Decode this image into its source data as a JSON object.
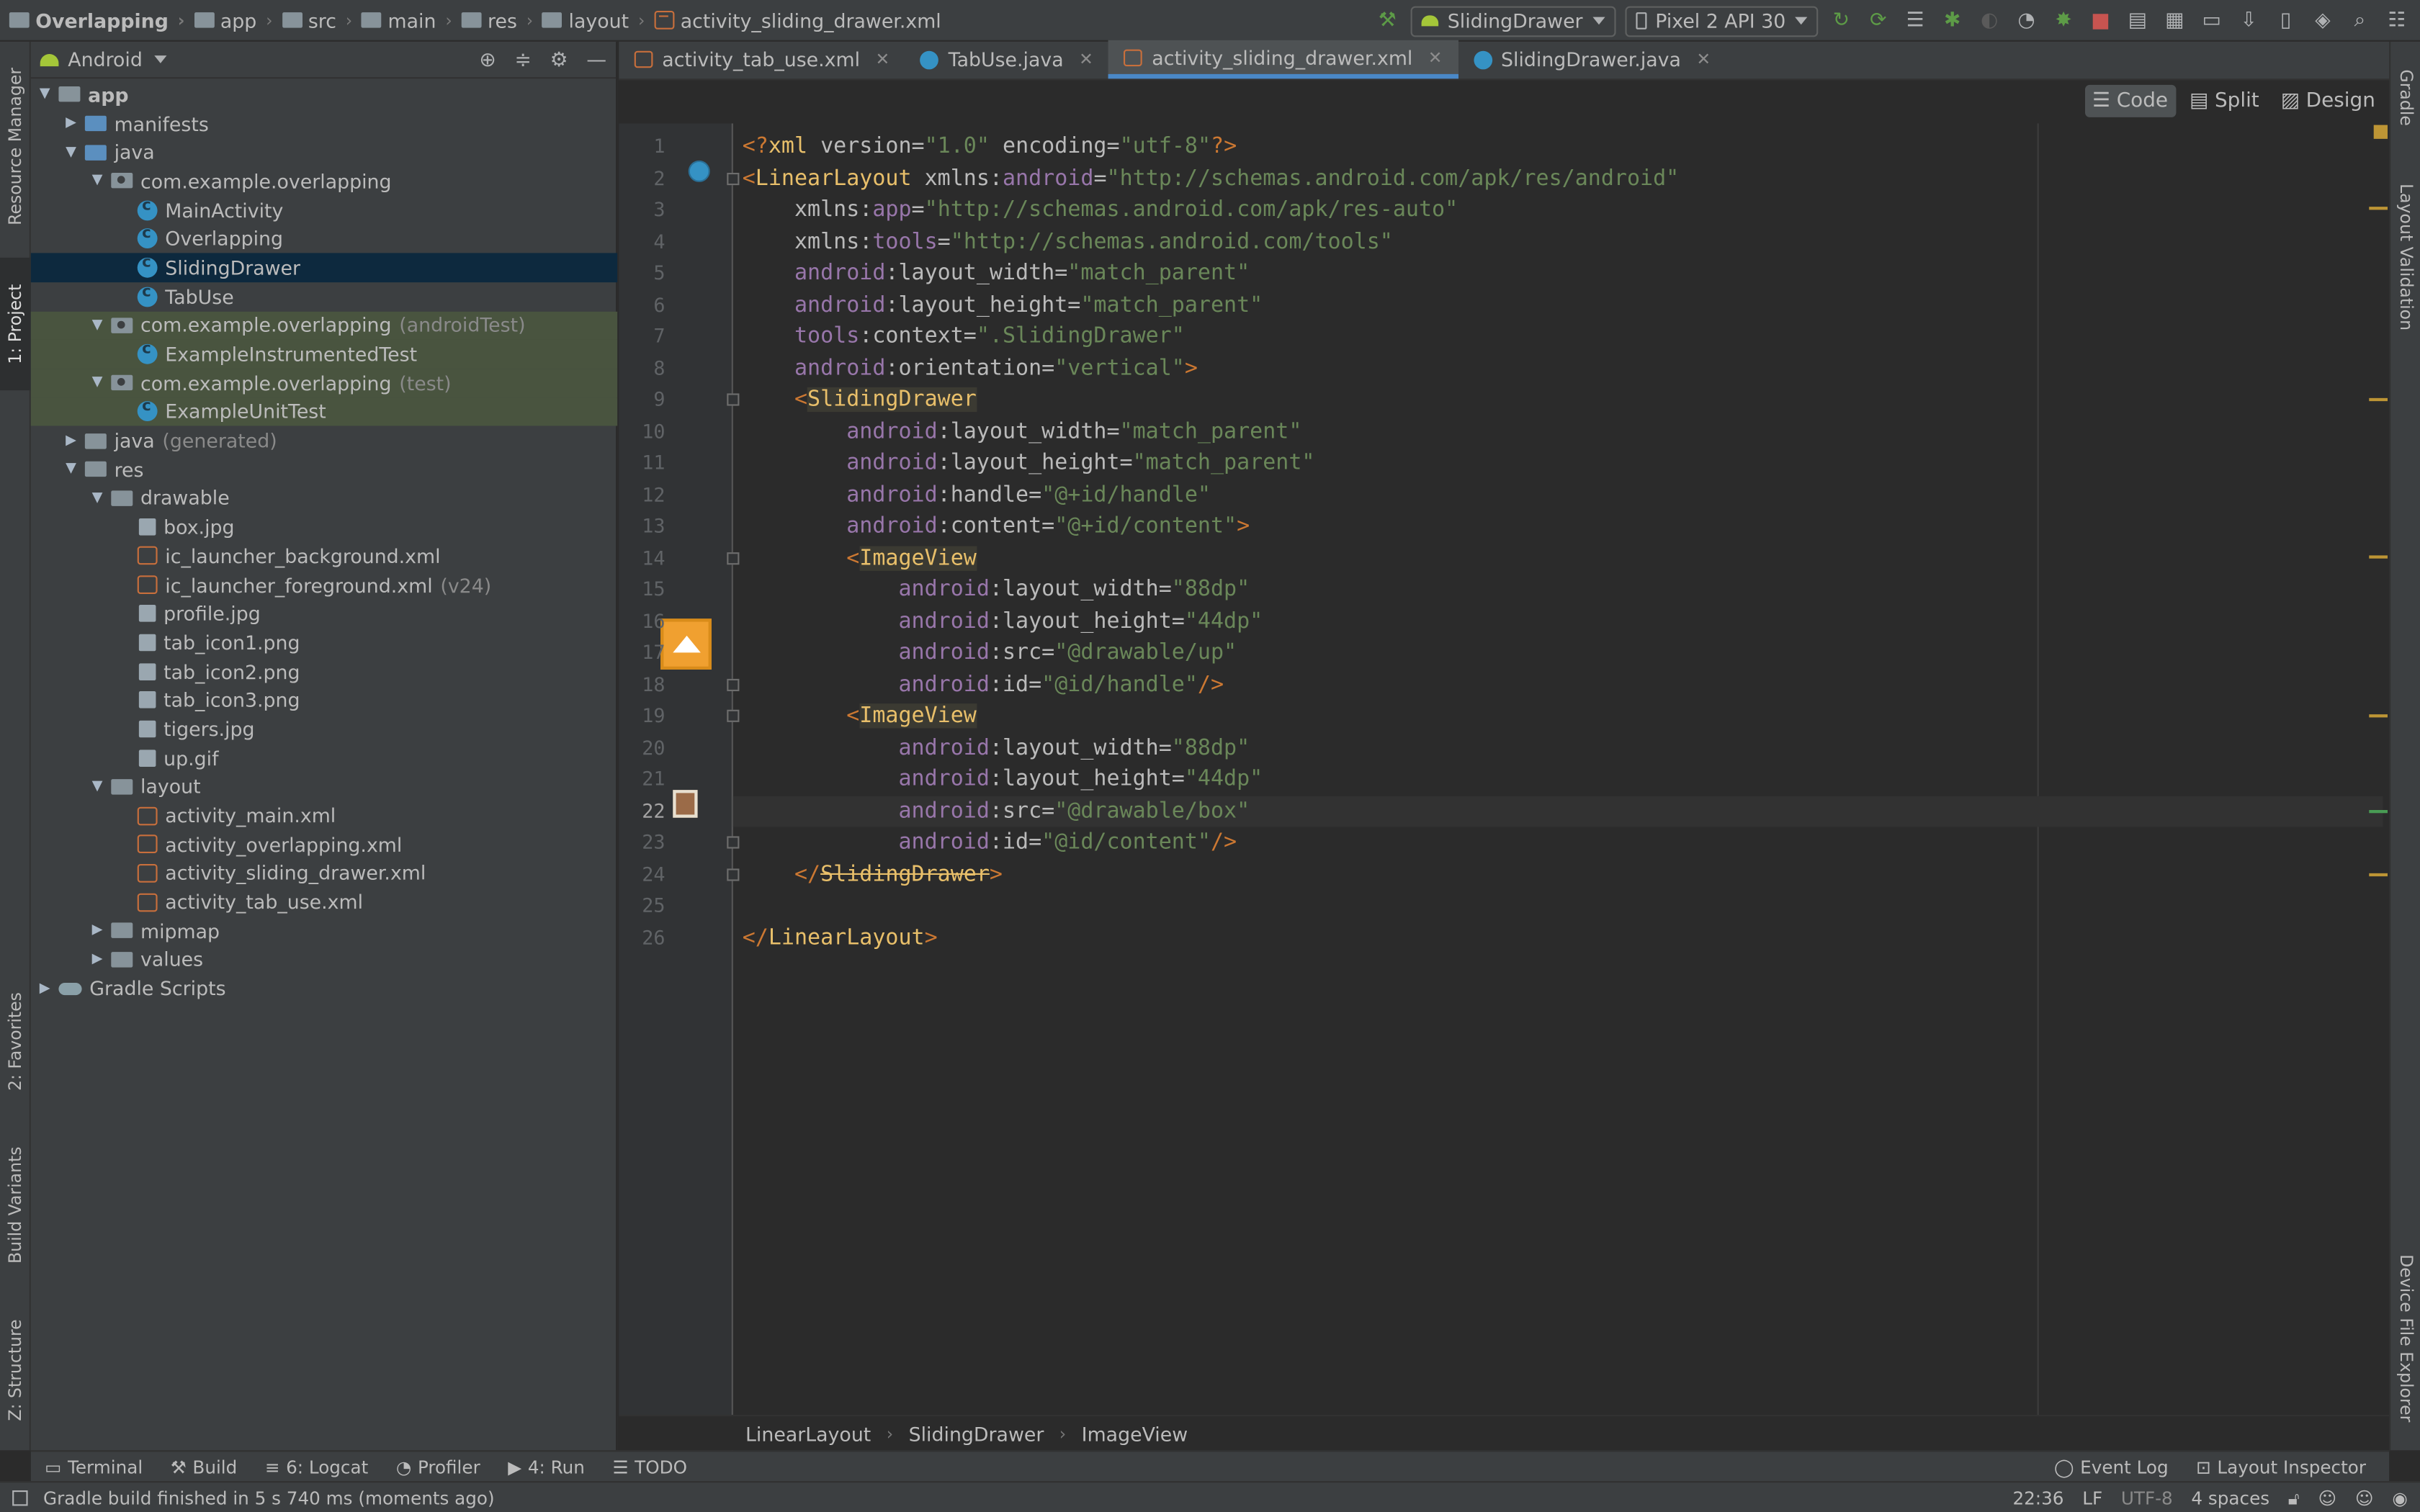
{
  "breadcrumbs": [
    "Overlapping",
    "app",
    "src",
    "main",
    "res",
    "layout",
    "activity_sliding_drawer.xml"
  ],
  "run_config": "SlidingDrawer",
  "device": "Pixel 2 API 30",
  "left_tabs": [
    "Resource Manager",
    "1: Project",
    "2: Favorites",
    "Build Variants",
    "Z: Structure"
  ],
  "right_tabs": [
    "Gradle",
    "Layout Validation",
    "Device File Explorer"
  ],
  "project_panel": {
    "view": "Android",
    "tree": [
      {
        "label": "app",
        "depth": 0,
        "icon": "folder",
        "arrow": "down",
        "bold": true
      },
      {
        "label": "manifests",
        "depth": 1,
        "icon": "folder-blue",
        "arrow": "right"
      },
      {
        "label": "java",
        "depth": 1,
        "icon": "folder-blue",
        "arrow": "down"
      },
      {
        "label": "com.example.overlapping",
        "depth": 2,
        "icon": "pkg",
        "arrow": "down"
      },
      {
        "label": "MainActivity",
        "depth": 3,
        "icon": "class"
      },
      {
        "label": "Overlapping",
        "depth": 3,
        "icon": "class"
      },
      {
        "label": "SlidingDrawer",
        "depth": 3,
        "icon": "class",
        "selected": true
      },
      {
        "label": "TabUse",
        "depth": 3,
        "icon": "class"
      },
      {
        "label": "com.example.overlapping",
        "suffix": "(androidTest)",
        "depth": 2,
        "icon": "pkg",
        "arrow": "down",
        "green": true
      },
      {
        "label": "ExampleInstrumentedTest",
        "depth": 3,
        "icon": "class",
        "green": true
      },
      {
        "label": "com.example.overlapping",
        "suffix": "(test)",
        "depth": 2,
        "icon": "pkg",
        "arrow": "down",
        "green": true
      },
      {
        "label": "ExampleUnitTest",
        "depth": 3,
        "icon": "class",
        "green": true
      },
      {
        "label": "java",
        "suffix": "(generated)",
        "depth": 1,
        "icon": "folder",
        "arrow": "right"
      },
      {
        "label": "res",
        "depth": 1,
        "icon": "folder",
        "arrow": "down"
      },
      {
        "label": "drawable",
        "depth": 2,
        "icon": "folder",
        "arrow": "down"
      },
      {
        "label": "box.jpg",
        "depth": 3,
        "icon": "img"
      },
      {
        "label": "ic_launcher_background.xml",
        "depth": 3,
        "icon": "xml"
      },
      {
        "label": "ic_launcher_foreground.xml",
        "suffix": "(v24)",
        "depth": 3,
        "icon": "xml"
      },
      {
        "label": "profile.jpg",
        "depth": 3,
        "icon": "img"
      },
      {
        "label": "tab_icon1.png",
        "depth": 3,
        "icon": "img"
      },
      {
        "label": "tab_icon2.png",
        "depth": 3,
        "icon": "img"
      },
      {
        "label": "tab_icon3.png",
        "depth": 3,
        "icon": "img"
      },
      {
        "label": "tigers.jpg",
        "depth": 3,
        "icon": "img"
      },
      {
        "label": "up.gif",
        "depth": 3,
        "icon": "img"
      },
      {
        "label": "layout",
        "depth": 2,
        "icon": "folder",
        "arrow": "down"
      },
      {
        "label": "activity_main.xml",
        "depth": 3,
        "icon": "xml"
      },
      {
        "label": "activity_overlapping.xml",
        "depth": 3,
        "icon": "xml"
      },
      {
        "label": "activity_sliding_drawer.xml",
        "depth": 3,
        "icon": "xml"
      },
      {
        "label": "activity_tab_use.xml",
        "depth": 3,
        "icon": "xml"
      },
      {
        "label": "mipmap",
        "depth": 2,
        "icon": "folder",
        "arrow": "right"
      },
      {
        "label": "values",
        "depth": 2,
        "icon": "folder",
        "arrow": "right"
      },
      {
        "label": "Gradle Scripts",
        "depth": 0,
        "icon": "gradle",
        "arrow": "right"
      }
    ]
  },
  "editor_tabs": [
    {
      "label": "activity_tab_use.xml",
      "type": "xml",
      "active": false
    },
    {
      "label": "TabUse.java",
      "type": "class",
      "active": false
    },
    {
      "label": "activity_sliding_drawer.xml",
      "type": "xml",
      "active": true
    },
    {
      "label": "SlidingDrawer.java",
      "type": "class",
      "active": false
    }
  ],
  "view_modes": [
    "Code",
    "Split",
    "Design"
  ],
  "code_lines": [
    [
      [
        "tk",
        "<?"
      ],
      [
        "tg",
        "xml "
      ],
      [
        "at",
        "version="
      ],
      [
        "st",
        "\"1.0\""
      ],
      [
        "at",
        " encoding="
      ],
      [
        "st",
        "\"utf-8\""
      ],
      [
        "tk",
        "?>"
      ]
    ],
    [
      [
        "tk",
        "<"
      ],
      [
        "tg",
        "LinearLayout "
      ],
      [
        "at",
        "xmlns:"
      ],
      [
        "ns",
        "android"
      ],
      [
        "at",
        "="
      ],
      [
        "st",
        "\"http://schemas.android.com/apk/res/android\""
      ]
    ],
    [
      [
        "at",
        "    xmlns:"
      ],
      [
        "ns",
        "app"
      ],
      [
        "at",
        "="
      ],
      [
        "st",
        "\"http://schemas.android.com/apk/res-auto\""
      ]
    ],
    [
      [
        "at",
        "    xmlns:"
      ],
      [
        "ns",
        "tools"
      ],
      [
        "at",
        "="
      ],
      [
        "st",
        "\"http://schemas.android.com/tools\""
      ]
    ],
    [
      [
        "ns",
        "    android"
      ],
      [
        "at",
        ":layout_width="
      ],
      [
        "st",
        "\"match_parent\""
      ]
    ],
    [
      [
        "ns",
        "    android"
      ],
      [
        "at",
        ":layout_height="
      ],
      [
        "st",
        "\"match_parent\""
      ]
    ],
    [
      [
        "ns",
        "    tools"
      ],
      [
        "at",
        ":context="
      ],
      [
        "st",
        "\".SlidingDrawer\""
      ]
    ],
    [
      [
        "ns",
        "    android"
      ],
      [
        "at",
        ":orientation="
      ],
      [
        "st",
        "\"vertical\""
      ],
      [
        "tk",
        ">"
      ]
    ],
    [
      [
        "tk",
        "    <"
      ],
      [
        "tg hl",
        "SlidingDrawer"
      ]
    ],
    [
      [
        "ns",
        "        android"
      ],
      [
        "at",
        ":layout_width="
      ],
      [
        "st",
        "\"match_parent\""
      ]
    ],
    [
      [
        "ns",
        "        android"
      ],
      [
        "at",
        ":layout_height="
      ],
      [
        "st",
        "\"match_parent\""
      ]
    ],
    [
      [
        "ns",
        "        android"
      ],
      [
        "at",
        ":handle="
      ],
      [
        "st",
        "\"@+id/handle\""
      ]
    ],
    [
      [
        "ns",
        "        android"
      ],
      [
        "at",
        ":content="
      ],
      [
        "st",
        "\"@+id/content\""
      ],
      [
        "tk",
        ">"
      ]
    ],
    [
      [
        "tk",
        "        <"
      ],
      [
        "tg hl",
        "ImageView"
      ]
    ],
    [
      [
        "ns",
        "            android"
      ],
      [
        "at",
        ":layout_width="
      ],
      [
        "st",
        "\"88dp\""
      ]
    ],
    [
      [
        "ns",
        "            android"
      ],
      [
        "at",
        ":layout_height="
      ],
      [
        "st",
        "\"44dp\""
      ]
    ],
    [
      [
        "ns",
        "            android"
      ],
      [
        "at",
        ":src="
      ],
      [
        "st",
        "\"@drawable/up\""
      ]
    ],
    [
      [
        "ns",
        "            android"
      ],
      [
        "at",
        ":id="
      ],
      [
        "st",
        "\"@id/handle\""
      ],
      [
        "tk",
        "/>"
      ]
    ],
    [
      [
        "tk",
        "        <"
      ],
      [
        "tg hl",
        "ImageView"
      ]
    ],
    [
      [
        "ns",
        "            android"
      ],
      [
        "at",
        ":layout_width="
      ],
      [
        "st",
        "\"88dp\""
      ]
    ],
    [
      [
        "ns",
        "            android"
      ],
      [
        "at",
        ":layout_height="
      ],
      [
        "st",
        "\"44dp\""
      ]
    ],
    [
      [
        "ns",
        "            android"
      ],
      [
        "at",
        ":src="
      ],
      [
        "st",
        "\"@drawable/box\""
      ]
    ],
    [
      [
        "ns",
        "            android"
      ],
      [
        "at",
        ":id="
      ],
      [
        "st",
        "\"@id/content\""
      ],
      [
        "tk",
        "/>"
      ]
    ],
    [
      [
        "tk",
        "    </"
      ],
      [
        "tg strike",
        "SlidingDrawer"
      ],
      [
        "tk",
        ">"
      ]
    ],
    [
      [
        "at",
        ""
      ]
    ],
    [
      [
        "tk",
        "</"
      ],
      [
        "tg",
        "LinearLayout"
      ],
      [
        "tk",
        ">"
      ]
    ]
  ],
  "current_line": 22,
  "editor_breadcrumb": [
    "LinearLayout",
    "SlidingDrawer",
    "ImageView"
  ],
  "bottom_tools": [
    "Terminal",
    "Build",
    "6: Logcat",
    "Profiler",
    "4: Run",
    "TODO"
  ],
  "bottom_tools_right": [
    "Event Log",
    "Layout Inspector"
  ],
  "status": {
    "message": "Gradle build finished in 5 s 740 ms (moments ago)",
    "position": "22:36",
    "line_sep": "LF",
    "encoding": "UTF-8",
    "indent": "4 spaces"
  },
  "colors": {
    "accent": "#4a88c7",
    "selection": "#0d293e",
    "test_bg": "#49543f",
    "tag": "#e8bf6a",
    "string": "#6a8759",
    "namespace": "#9876aa"
  }
}
